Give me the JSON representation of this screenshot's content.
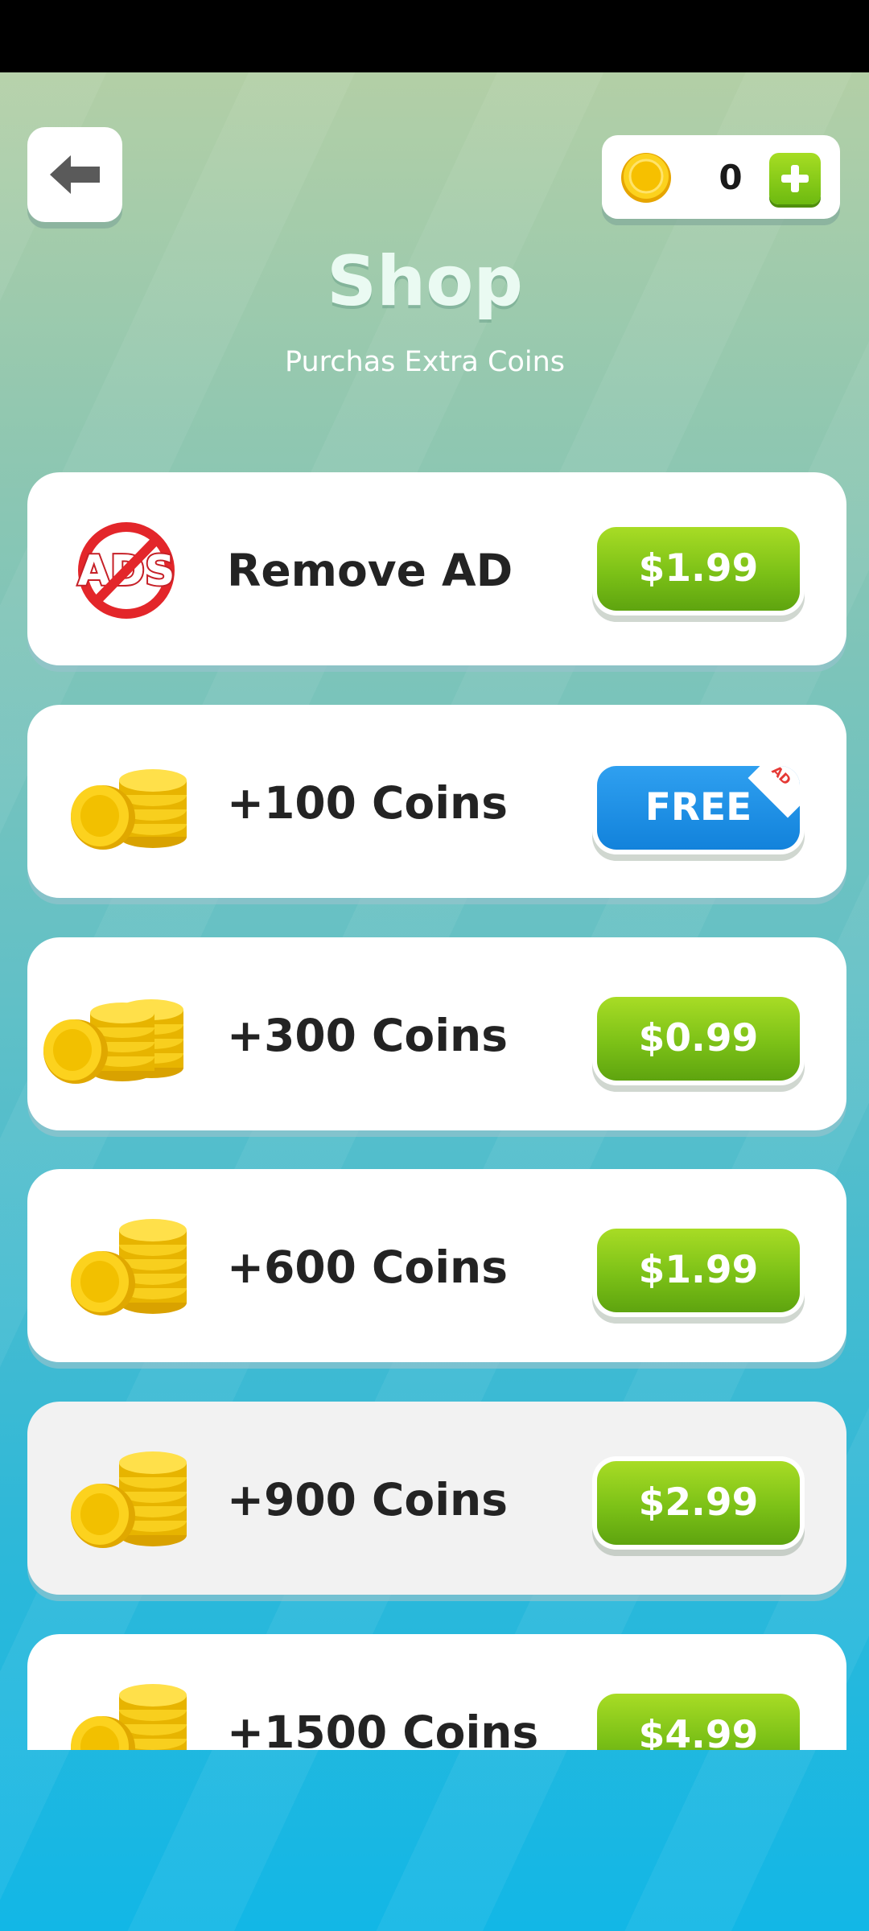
{
  "header": {
    "back_icon": "arrow-left-icon",
    "coin_balance": "0",
    "add_icon": "plus-icon"
  },
  "title": "Shop",
  "subtitle": "Purchas Extra Coins",
  "items": [
    {
      "label": "Remove AD",
      "price": "$1.99",
      "icon": "no-ads-icon"
    },
    {
      "label": "+100 Coins",
      "price": "FREE",
      "badge": "AD",
      "icon": "coins-small-stack-icon"
    },
    {
      "label": "+300 Coins",
      "price": "$0.99",
      "icon": "coins-pile-icon"
    },
    {
      "label": "+600 Coins",
      "price": "$1.99",
      "icon": "coins-stack-icon"
    },
    {
      "label": "+900 Coins",
      "price": "$2.99",
      "icon": "coins-stack-icon"
    },
    {
      "label": "+1500 Coins",
      "price": "$4.99",
      "icon": "coins-stack-icon"
    }
  ],
  "colors": {
    "buy_green": "#7cc117",
    "free_blue": "#1a8be6",
    "coin_gold": "#f2c40d"
  }
}
